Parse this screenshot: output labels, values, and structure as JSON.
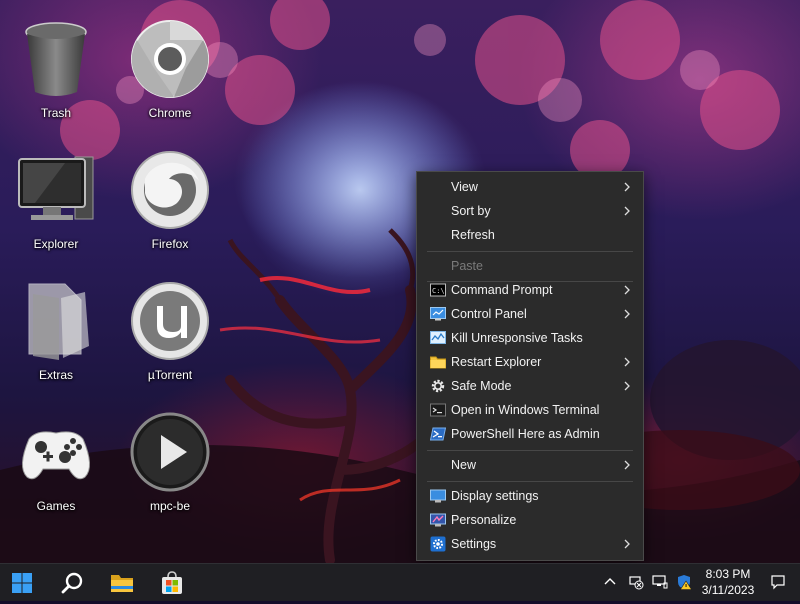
{
  "desktop": {
    "icons": [
      {
        "label": "Trash",
        "icon": "trash-icon"
      },
      {
        "label": "Chrome",
        "icon": "chrome-icon"
      },
      {
        "label": "Explorer",
        "icon": "computer-icon"
      },
      {
        "label": "Firefox",
        "icon": "firefox-icon"
      },
      {
        "label": "Extras",
        "icon": "folder-icon"
      },
      {
        "label": "µTorrent",
        "icon": "utorrent-icon"
      },
      {
        "label": "Games",
        "icon": "gamepad-icon"
      },
      {
        "label": "mpc-be",
        "icon": "play-icon"
      }
    ]
  },
  "context_menu": {
    "items": [
      {
        "label": "View",
        "submenu": true
      },
      {
        "label": "Sort by",
        "submenu": true
      },
      {
        "label": "Refresh",
        "submenu": false
      },
      {
        "label": "Paste",
        "submenu": false,
        "disabled": true
      },
      {
        "label": "Command Prompt",
        "submenu": true,
        "icon": "cmd-icon"
      },
      {
        "label": "Control Panel",
        "submenu": true,
        "icon": "control-panel-icon"
      },
      {
        "label": "Kill Unresponsive Tasks",
        "submenu": false,
        "icon": "task-monitor-icon"
      },
      {
        "label": "Restart Explorer",
        "submenu": true,
        "icon": "folder-icon"
      },
      {
        "label": "Safe Mode",
        "submenu": true,
        "icon": "gear-icon"
      },
      {
        "label": "Open in Windows Terminal",
        "submenu": false,
        "icon": "terminal-icon"
      },
      {
        "label": "PowerShell Here as Admin",
        "submenu": false,
        "icon": "powershell-icon"
      },
      {
        "label": "New",
        "submenu": true
      },
      {
        "label": "Display settings",
        "submenu": false,
        "icon": "display-icon"
      },
      {
        "label": "Personalize",
        "submenu": false,
        "icon": "personalize-icon"
      },
      {
        "label": "Settings",
        "submenu": true,
        "icon": "settings-gear-icon"
      }
    ]
  },
  "taskbar": {
    "buttons": [
      "windows-start-icon",
      "search-icon",
      "file-explorer-icon",
      "store-icon"
    ],
    "tray": [
      "chevron-up-icon",
      "network-off-icon",
      "network-icon",
      "security-warning-icon"
    ],
    "time": "8:03 PM",
    "date": "3/11/2023",
    "notification": "notification-icon"
  },
  "colors": {
    "menu_bg": "#2b2b2b",
    "menu_text": "#f2f2f2",
    "menu_disabled": "#7a7a7a",
    "taskbar_bg": "#1f1f23",
    "accent": "#0078d4"
  }
}
